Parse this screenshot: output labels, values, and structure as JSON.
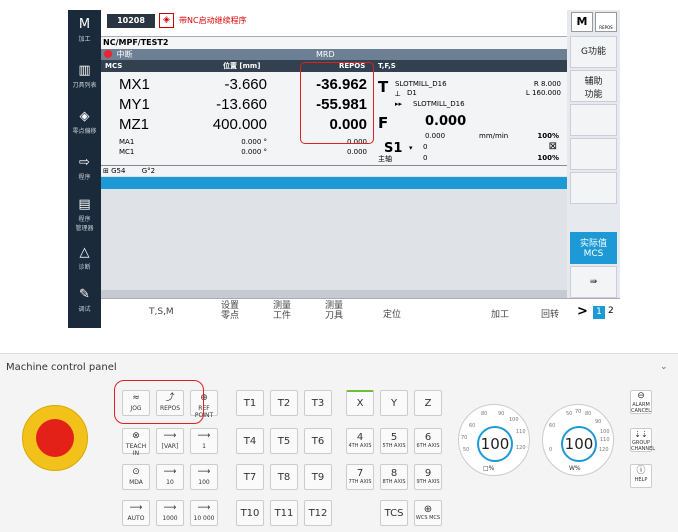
{
  "hmi": {
    "alarm_number": "10208",
    "alarm_text": "带NC启动继续程序",
    "program_path": "NC/MPF/TEST2",
    "channel_status": "中断",
    "mode": "MRD",
    "left_nav": [
      {
        "label": "加工",
        "icon": "M"
      },
      {
        "label": "刀具列表",
        "icon": "▥"
      },
      {
        "label": "零点偏移",
        "icon": "◈"
      },
      {
        "label": "程序",
        "icon": "⇨"
      },
      {
        "label": "程序\n管理器",
        "icon": "▤"
      },
      {
        "label": "诊断",
        "icon": "△"
      },
      {
        "label": "调试",
        "icon": "✎"
      }
    ],
    "top_right_icons": [
      {
        "label": "M"
      },
      {
        "label": "REPOS"
      }
    ],
    "axis_header": {
      "mcs": "MCS",
      "pos": "位置 [mm]",
      "repos": "REPOS",
      "tfs": "T,F,S"
    },
    "axes": [
      {
        "name": "MX1",
        "pos": "-3.660",
        "repos": "-36.962"
      },
      {
        "name": "MY1",
        "pos": "-13.660",
        "repos": "-55.981"
      },
      {
        "name": "MZ1",
        "pos": "400.000",
        "repos": "0.000"
      }
    ],
    "minor_axes": [
      {
        "name": "MA1",
        "pos": "0.000 °",
        "repos": "0.000"
      },
      {
        "name": "MC1",
        "pos": "0.000 °",
        "repos": "0.000"
      }
    ],
    "tfs": {
      "tool": "SLOTMILL_D16",
      "tool_sub": "D1",
      "tool_next": "SLOTMILL_D16",
      "r": "R 8.000",
      "l": "L 160.000",
      "feed": "0.000",
      "feed_sub": "0.000",
      "feed_unit": "mm/min",
      "feed_pct": "100%",
      "spindle": "S1",
      "spindle_val": "0",
      "spindle_main": "主轴",
      "spindle_main_val": "0",
      "spindle_pct": "100%"
    },
    "offset_row": {
      "label": "G54",
      "extra": "G°2"
    },
    "right_softkeys": [
      {
        "label": "G功能"
      },
      {
        "label": "辅助\n功能"
      },
      {
        "label": ""
      },
      {
        "label": ""
      },
      {
        "label": ""
      },
      {
        "label": "实际值\nMCS"
      },
      {
        "label": "⇛"
      }
    ],
    "bottom_softkeys": [
      {
        "label": "T,S,M"
      },
      {
        "label": "设置\n零点"
      },
      {
        "label": "测量\n工件"
      },
      {
        "label": "测量\n刀具"
      },
      {
        "label": "定位"
      },
      {
        "label": "加工"
      },
      {
        "label": "回转"
      },
      {
        "label": ">"
      },
      {
        "label": "1"
      },
      {
        "label": "2"
      }
    ]
  },
  "mcp": {
    "title": "Machine control panel",
    "mode_keys": [
      {
        "sym": "≈",
        "label": "JOG"
      },
      {
        "sym": "⤴",
        "label": "REPOS"
      },
      {
        "sym": "⊕",
        "label": "REF POINT"
      },
      {
        "sym": "⊗",
        "label": "TEACH IN"
      },
      {
        "sym": "⟶",
        "label": "[VAR]"
      },
      {
        "sym": "⟶",
        "label": "1"
      },
      {
        "sym": "⊙",
        "label": "MDA"
      },
      {
        "sym": "⟶",
        "label": "10"
      },
      {
        "sym": "⟶",
        "label": "100"
      },
      {
        "sym": "⟶",
        "label": "AUTO"
      },
      {
        "sym": "⟶",
        "label": "1000"
      },
      {
        "sym": "⟶",
        "label": "10 000"
      }
    ],
    "t_keys": [
      "T1",
      "T2",
      "T3",
      "T4",
      "T5",
      "T6",
      "T7",
      "T8",
      "T9",
      "T10",
      "T11",
      "T12"
    ],
    "axis_keys": [
      {
        "n": "X",
        "s": ""
      },
      {
        "n": "Y",
        "s": ""
      },
      {
        "n": "Z",
        "s": ""
      },
      {
        "n": "4",
        "s": "4TH AXIS"
      },
      {
        "n": "5",
        "s": "5TH AXIS"
      },
      {
        "n": "6",
        "s": "6TH AXIS"
      },
      {
        "n": "7",
        "s": "7TH AXIS"
      },
      {
        "n": "8",
        "s": "8TH AXIS"
      },
      {
        "n": "9",
        "s": "9TH AXIS"
      },
      {
        "n": "TCS",
        "s": ""
      },
      {
        "n": "⊕",
        "s": "WCS MCS"
      }
    ],
    "feed_override": {
      "value": "100",
      "unit": "□%"
    },
    "spindle_override": {
      "value": "100",
      "unit": "W%"
    },
    "feed_ticks": [
      "60",
      "80",
      "90",
      "100",
      "110",
      "120",
      "70",
      "50"
    ],
    "spindle_ticks": [
      "50",
      "70",
      "80",
      "90",
      "100",
      "110",
      "120",
      "60",
      "0"
    ],
    "side_keys": [
      {
        "label": "ALARM CANCEL"
      },
      {
        "label": "GROUP CHANNEL"
      },
      {
        "label": "HELP"
      }
    ]
  }
}
